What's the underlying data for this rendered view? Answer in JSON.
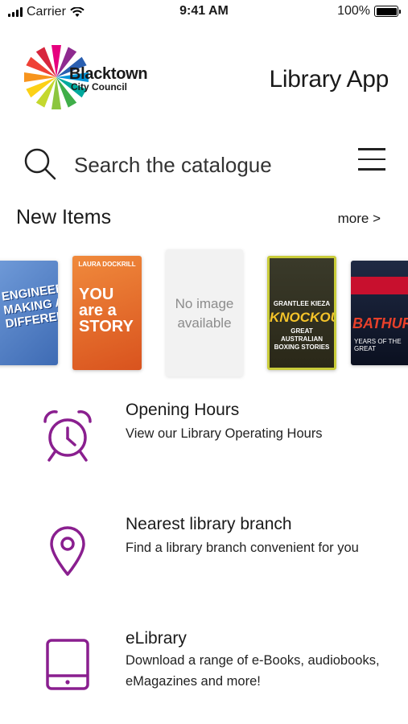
{
  "status_bar": {
    "carrier": "Carrier",
    "time": "9:41 AM",
    "battery": "100%"
  },
  "header": {
    "logo_name": "Blacktown",
    "logo_sub": "City Council",
    "app_title": "Library App"
  },
  "search": {
    "placeholder": "Search the catalogue"
  },
  "new_items": {
    "title": "New Items",
    "more_label": "more >",
    "books": [
      {
        "title_text": "ENGINEERS MAKING A DIFFERENCE"
      },
      {
        "author": "LAURA DOCKRILL",
        "title_text": "YOU are a STORY"
      },
      {
        "title_text": "No image available"
      },
      {
        "author": "GRANTLEE KIEZA",
        "title_text": "KNOCKOUT",
        "subtitle": "GREAT AUSTRALIAN BOXING STORIES"
      },
      {
        "title_text": "BATHURST",
        "subtitle": "YEARS OF THE GREAT"
      }
    ]
  },
  "features": [
    {
      "icon": "alarm-clock-icon",
      "title": "Opening Hours",
      "description": "View our Library Operating Hours"
    },
    {
      "icon": "location-pin-icon",
      "title": "Nearest library branch",
      "description": "Find a library branch convenient for you"
    },
    {
      "icon": "tablet-icon",
      "title": "eLibrary",
      "description": "Download a range of e-Books, audiobooks, eMagazines and more!"
    }
  ],
  "colors": {
    "accent_purple": "#8a1f8f"
  }
}
